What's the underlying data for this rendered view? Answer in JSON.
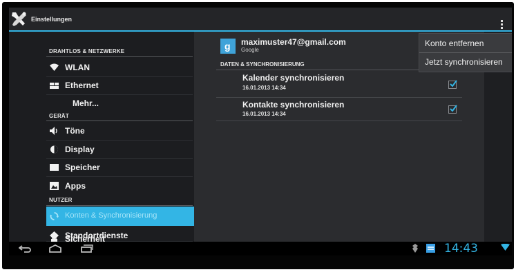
{
  "actionbar": {
    "title": "Einstellungen",
    "app_icon": "tools-icon",
    "overflow_icon": "overflow-menu-icon"
  },
  "sidebar": {
    "headers": [
      "DRAHTLOS & NETZWERKE",
      "GERÄT",
      "NUTZER"
    ],
    "items": [
      {
        "label": "WLAN",
        "icon": "wifi-icon"
      },
      {
        "label": "Ethernet",
        "icon": "ethernet-icon"
      },
      {
        "label": "Mehr...",
        "icon": ""
      },
      {
        "label": "Töne",
        "icon": "speaker-icon"
      },
      {
        "label": "Display",
        "icon": "display-icon"
      },
      {
        "label": "Speicher",
        "icon": "storage-icon"
      },
      {
        "label": "Apps",
        "icon": "apps-icon"
      },
      {
        "label": "Konten & Synchronisierung",
        "icon": "sync-icon",
        "selected": true
      },
      {
        "label": "Standortdienste",
        "icon": "location-icon"
      },
      {
        "label": "Sicherheit",
        "icon": "lock-icon"
      }
    ]
  },
  "account": {
    "email": "maximuster47@gmail.com",
    "type": "Google",
    "icon": "google-icon",
    "section_header": "DATEN & SYNCHRONISIERUNG",
    "sync_items": [
      {
        "title": "Kalender synchronisieren",
        "date": "16.01.2013 14:34",
        "checked": true
      },
      {
        "title": "Kontakte synchronisieren",
        "date": "16.01.2013 14:34",
        "checked": true
      }
    ]
  },
  "menu": {
    "items": [
      "Konto entfernen",
      "Jetzt synchronisieren"
    ]
  },
  "navbar": {
    "clock": "14:43"
  },
  "colors": {
    "accent": "#33b5e5",
    "background": "#1a1b1e"
  }
}
